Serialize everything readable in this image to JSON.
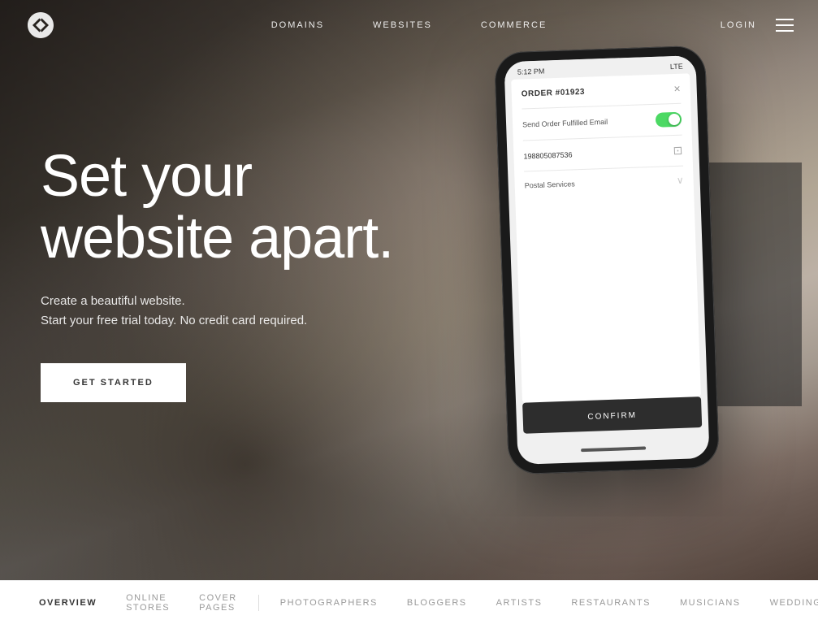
{
  "brand": {
    "name": "Squarespace",
    "logo_aria": "Squarespace logo"
  },
  "header": {
    "nav_items": [
      {
        "label": "DOMAINS",
        "id": "domains"
      },
      {
        "label": "WEBSITES",
        "id": "websites"
      },
      {
        "label": "COMMERCE",
        "id": "commerce"
      }
    ],
    "login_label": "LOGIN",
    "hamburger_aria": "Menu"
  },
  "hero": {
    "headline_line1": "Set your",
    "headline_line2": "website apart.",
    "subtext_line1": "Create a beautiful website.",
    "subtext_line2": "Start your free trial today. No credit card required.",
    "cta_label": "GET STARTED"
  },
  "phone": {
    "status_time": "5:12 PM",
    "status_signal": "LTE",
    "order_title": "ORDER #01923",
    "close_symbol": "×",
    "toggle_label": "Send Order Fulfilled Email",
    "tracking_number": "198805087536",
    "scan_icon": "⊞",
    "carrier_label": "Postal Services",
    "chevron": "›",
    "confirm_label": "CONFIRM"
  },
  "footer_nav": {
    "primary_items": [
      {
        "label": "OVERVIEW",
        "id": "overview",
        "active": true
      },
      {
        "label": "ONLINE STORES",
        "id": "online-stores",
        "active": false
      },
      {
        "label": "COVER PAGES",
        "id": "cover-pages",
        "active": false
      }
    ],
    "secondary_items": [
      {
        "label": "PHOTOGRAPHERS",
        "id": "photographers",
        "active": false
      },
      {
        "label": "BLOGGERS",
        "id": "bloggers",
        "active": false
      },
      {
        "label": "ARTISTS",
        "id": "artists",
        "active": false
      },
      {
        "label": "RESTAURANTS",
        "id": "restaurants",
        "active": false
      },
      {
        "label": "MUSICIANS",
        "id": "musicians",
        "active": false
      },
      {
        "label": "WEDDINGS",
        "id": "weddings",
        "active": false
      }
    ]
  }
}
